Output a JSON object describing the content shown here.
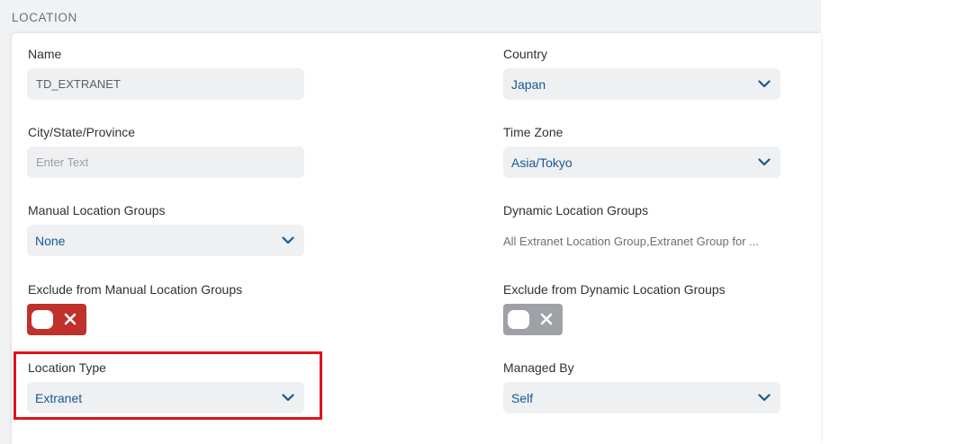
{
  "section": {
    "title": "LOCATION"
  },
  "fields": {
    "name": {
      "label": "Name",
      "value": "TD_EXTRANET"
    },
    "country": {
      "label": "Country",
      "value": "Japan"
    },
    "city": {
      "label": "City/State/Province",
      "placeholder": "Enter Text"
    },
    "timezone": {
      "label": "Time Zone",
      "value": "Asia/Tokyo"
    },
    "manual_groups": {
      "label": "Manual Location Groups",
      "value": "None"
    },
    "dynamic_groups": {
      "label": "Dynamic Location Groups",
      "value": "All Extranet Location Group,Extranet Group for ..."
    },
    "exclude_manual": {
      "label": "Exclude from Manual Location Groups",
      "state": "off"
    },
    "exclude_dynamic": {
      "label": "Exclude from Dynamic Location Groups",
      "state": "off"
    },
    "location_type": {
      "label": "Location Type",
      "value": "Extranet"
    },
    "managed_by": {
      "label": "Managed By",
      "value": "Self"
    }
  },
  "colors": {
    "accent_value": "#165993",
    "toggle_red": "#c0312b",
    "toggle_gray": "#9ea1a6",
    "highlight": "#e0131c"
  },
  "icons": {
    "dropdown": "chevron-down-icon",
    "toggle_off": "close-icon"
  }
}
